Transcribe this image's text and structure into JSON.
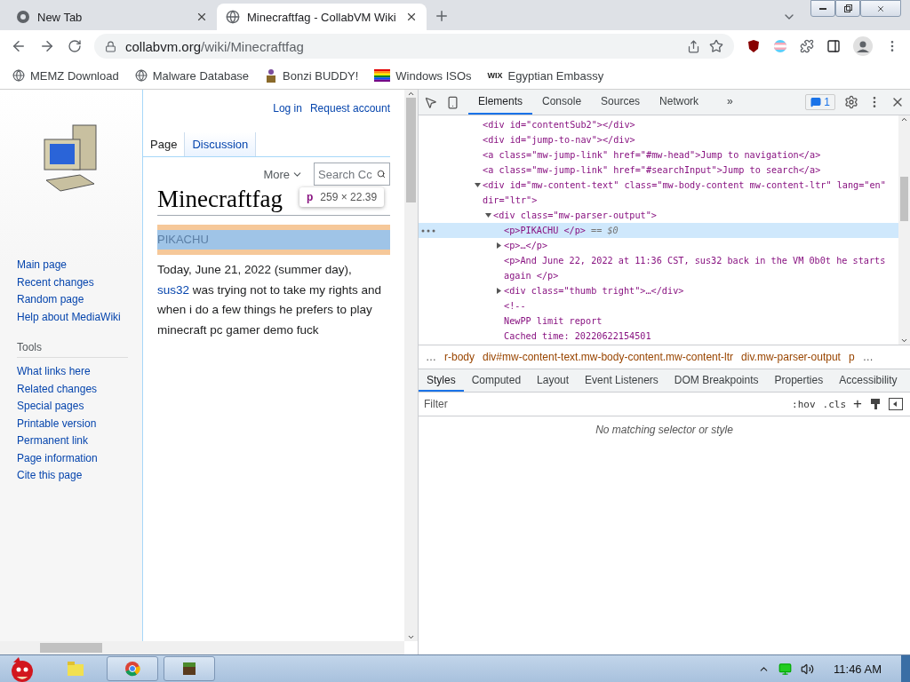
{
  "browser": {
    "tabs": [
      {
        "title": "New Tab",
        "selected": false
      },
      {
        "title": "Minecraftfag - CollabVM Wiki",
        "selected": true
      }
    ],
    "address": {
      "host": "collabvm.org",
      "path": "/wiki/Minecraftfag"
    },
    "bookmarks": [
      {
        "label": "MEMZ Download",
        "kind": "globe"
      },
      {
        "label": "Malware Database",
        "kind": "globe"
      },
      {
        "label": "Bonzi BUDDY!",
        "kind": "figure"
      },
      {
        "label": "Windows ISOs",
        "kind": "flag"
      },
      {
        "label": "Egyptian Embassy",
        "kind": "logo",
        "logo": "WIX"
      }
    ]
  },
  "wiki": {
    "personal_links": [
      "Log in",
      "Request account"
    ],
    "navigation": [
      "Main page",
      "Recent changes",
      "Random page",
      "Help about MediaWiki"
    ],
    "tools_heading": "Tools",
    "tools": [
      "What links here",
      "Related changes",
      "Special pages",
      "Printable version",
      "Permanent link",
      "Page information",
      "Cite this page"
    ],
    "page_tabs": [
      {
        "label": "Page",
        "selected": true
      },
      {
        "label": "Discussion",
        "selected": false
      }
    ],
    "more": "More",
    "search_placeholder": "Search Cc",
    "title": "Minecraftfag",
    "inspect_tooltip": {
      "tag": "p",
      "size": "259 × 22.39"
    },
    "highlighted_paragraph": "PIKACHU",
    "paragraph": [
      {
        "kind": "text",
        "text": "Today, June 21, 2022 (summer day), "
      },
      {
        "kind": "link",
        "text": "sus32"
      },
      {
        "kind": "text",
        "text": " was trying not to take my rights and when i do a few things he prefers to play minecraft pc gamer demo fuck"
      }
    ]
  },
  "devtools": {
    "tabs": [
      {
        "label": "Elements",
        "selected": true
      },
      {
        "label": "Console",
        "selected": false
      },
      {
        "label": "Sources",
        "selected": false
      },
      {
        "label": "Network",
        "selected": false
      }
    ],
    "overflow": "»",
    "issues": "1",
    "dom_tree": [
      {
        "text": "<div id=\"contentSub2\"></div>",
        "selected": false
      },
      {
        "text": "<div id=\"jump-to-nav\"></div>",
        "selected": false
      },
      {
        "text": "<a class=\"mw-jump-link\" href=\"#mw-head\">Jump to navigation</a>",
        "selected": false
      },
      {
        "text": "<a class=\"mw-jump-link\" href=\"#searchInput\">Jump to search</a>",
        "selected": false
      },
      {
        "text": "<div id=\"mw-content-text\" class=\"mw-body-content mw-content-ltr\" lang=\"en\" dir=\"ltr\">",
        "selected": false,
        "expanded": true,
        "children": [
          {
            "text": "<div class=\"mw-parser-output\">",
            "selected": false,
            "expanded": true,
            "children": [
              {
                "text": "<p>PIKACHU </p>",
                "selected": true,
                "marker": "== $0"
              },
              {
                "text": "<p>…</p>",
                "selected": false,
                "expanded": false
              },
              {
                "text": "<p>And June 22, 2022 at 11:36 CST, sus32 back in the VM 0b0t he starts again </p>",
                "selected": false
              },
              {
                "text": "<div class=\"thumb tright\">…</div>",
                "selected": false,
                "expanded": false
              },
              {
                "text": "<!--",
                "selected": false
              },
              {
                "text": "NewPP limit report",
                "selected": false
              },
              {
                "text": "Cached time: 20220622154501",
                "selected": false
              }
            ]
          }
        ]
      }
    ],
    "breadcrumbs": [
      {
        "text": "…",
        "kind": "more"
      },
      {
        "text": "r-body",
        "kind": "crumb"
      },
      {
        "text": "div#mw-content-text.mw-body-content.mw-content-ltr",
        "kind": "crumb"
      },
      {
        "text": "div.mw-parser-output",
        "kind": "crumb"
      },
      {
        "text": "p",
        "kind": "crumb"
      },
      {
        "text": "…",
        "kind": "more"
      }
    ],
    "style_tabs": [
      {
        "label": "Styles",
        "selected": true
      },
      {
        "label": "Computed",
        "selected": false
      },
      {
        "label": "Layout",
        "selected": false
      },
      {
        "label": "Event Listeners",
        "selected": false
      },
      {
        "label": "DOM Breakpoints",
        "selected": false
      },
      {
        "label": "Properties",
        "selected": false
      },
      {
        "label": "Accessibility",
        "selected": false
      }
    ],
    "filter_placeholder": "Filter",
    "hov": ":hov",
    "cls": ".cls",
    "add": "+",
    "empty_message": "No matching selector or style"
  },
  "taskbar": {
    "time": "11:46 AM"
  }
}
